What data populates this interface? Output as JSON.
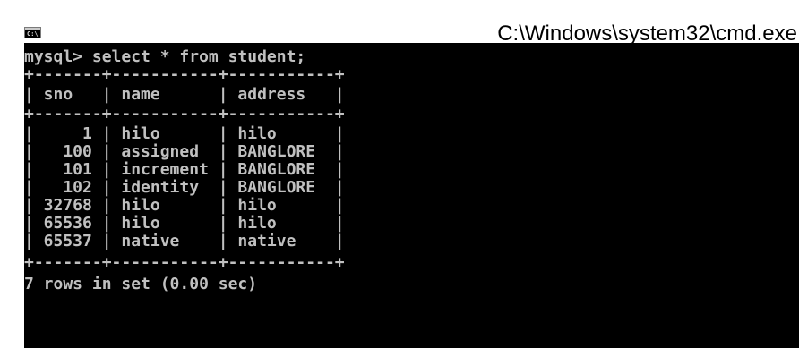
{
  "window": {
    "title": "C:\\Windows\\system32\\cmd.exe",
    "icon": "cmd-console-icon",
    "icon_glyph": "C:\\"
  },
  "console": {
    "colors": {
      "background": "#000000",
      "text": "#c0c0c0"
    },
    "prompt": "mysql> select * from student;",
    "border_top": "+-------+-----------+-----------+",
    "header": "| sno   | name      | address   |",
    "border_mid": "+-------+-----------+-----------+",
    "rows": [
      "|     1 | hilo      | hilo      |",
      "|   100 | assigned  | BANGLORE  |",
      "|   101 | increment | BANGLORE  |",
      "|   102 | identity  | BANGLORE  |",
      "| 32768 | hilo      | hilo      |",
      "| 65536 | hilo      | hilo      |",
      "| 65537 | native    | native    |"
    ],
    "border_bottom": "+-------+-----------+-----------+",
    "result": "7 rows in set (0.00 sec)"
  }
}
